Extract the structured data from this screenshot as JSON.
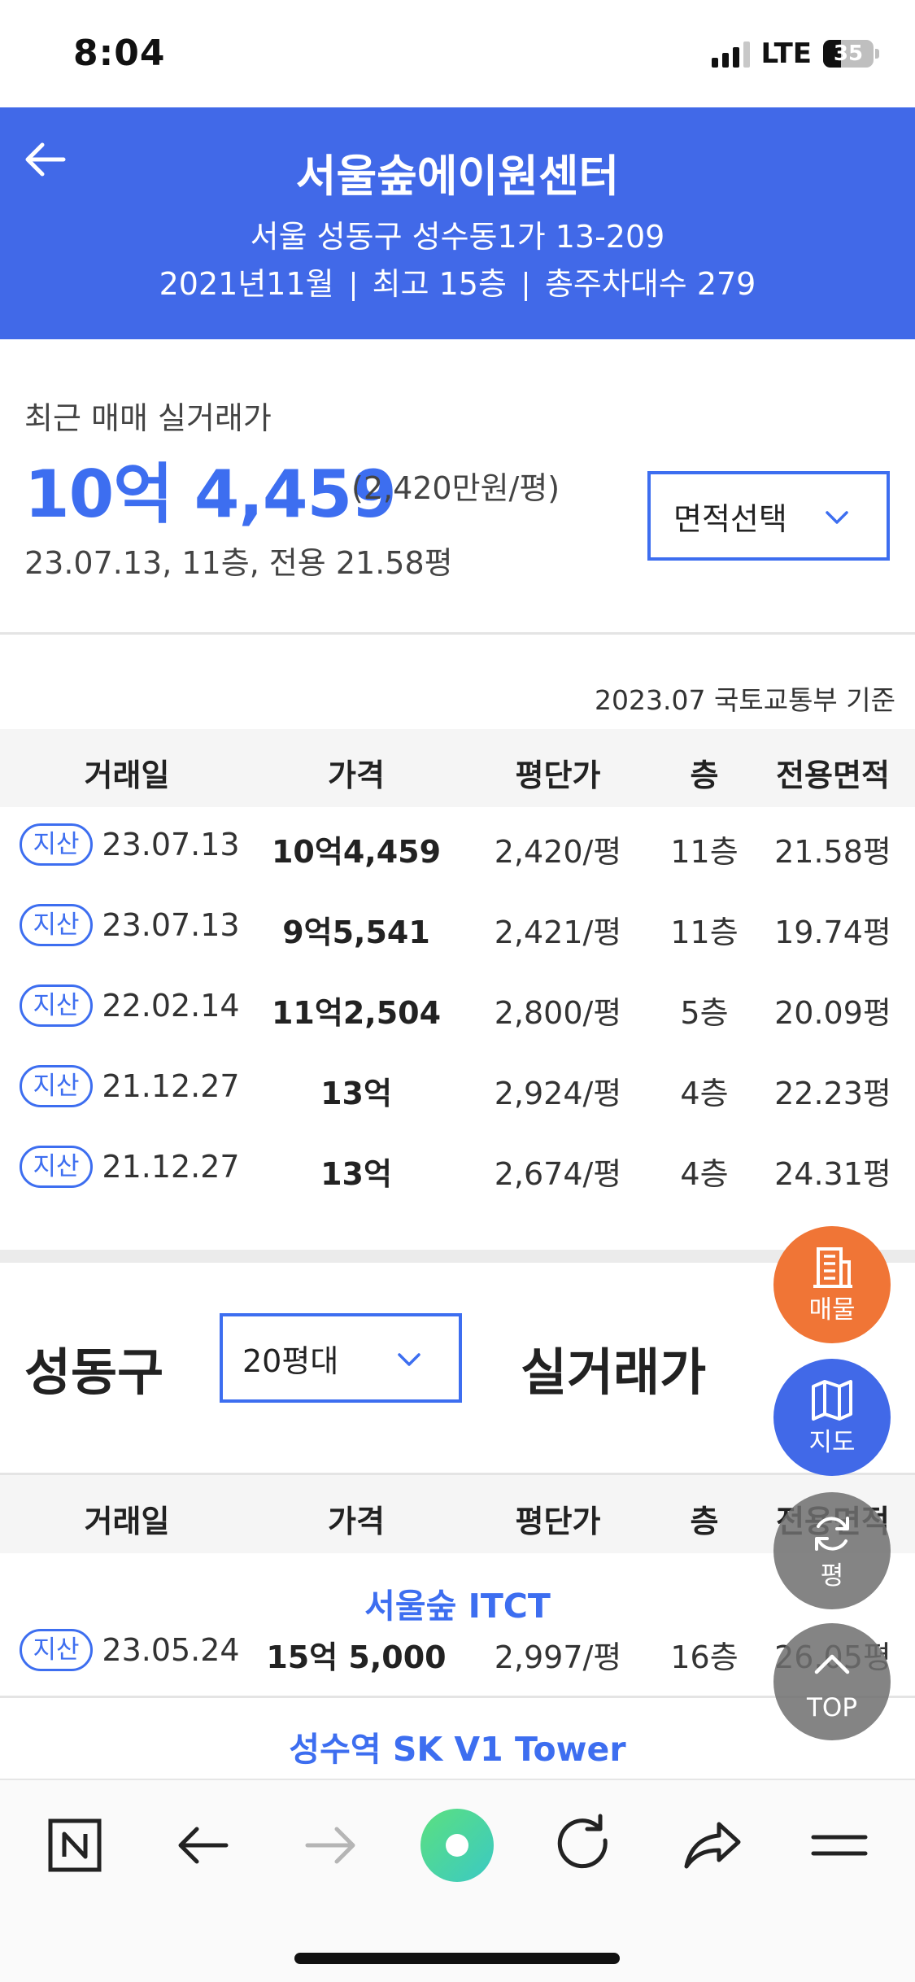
{
  "status_bar": {
    "time": "8:04",
    "network": "LTE",
    "battery": "35",
    "battery_level": 0.35
  },
  "header": {
    "title": "서울숲에이원센터",
    "address": "서울 성동구 성수동1가 13-209",
    "meta": [
      "2021년11월",
      "최고 15층",
      "총주차대수 279"
    ]
  },
  "recent": {
    "label": "최근 매매 실거래가",
    "price": "10억 4,459",
    "unit_price": "(2,420만원/평)",
    "detail": "23.07.13, 11층, 전용 21.58평",
    "area_select": "면적선택"
  },
  "basis": "2023.07 국토교통부 기준",
  "table_headers": [
    "거래일",
    "가격",
    "평단가",
    "층",
    "전용면적"
  ],
  "transactions": [
    {
      "badge": "지산",
      "date": "23.07.13",
      "price": "10억4,459",
      "unit": "2,420/평",
      "floor": "11층",
      "area": "21.58평"
    },
    {
      "badge": "지산",
      "date": "23.07.13",
      "price": "9억5,541",
      "unit": "2,421/평",
      "floor": "11층",
      "area": "19.74평"
    },
    {
      "badge": "지산",
      "date": "22.02.14",
      "price": "11억2,504",
      "unit": "2,800/평",
      "floor": "5층",
      "area": "20.09평"
    },
    {
      "badge": "지산",
      "date": "21.12.27",
      "price": "13억",
      "unit": "2,924/평",
      "floor": "4층",
      "area": "22.23평"
    },
    {
      "badge": "지산",
      "date": "21.12.27",
      "price": "13억",
      "unit": "2,674/평",
      "floor": "4층",
      "area": "24.31평"
    }
  ],
  "region": {
    "name": "성동구",
    "range": "20평대",
    "suffix": "실거래가"
  },
  "region_transactions": [
    {
      "complex": "서울숲 ITCT",
      "badge": "지산",
      "date": "23.05.24",
      "price": "15억 5,000",
      "unit": "2,997/평",
      "floor": "16층",
      "area": "26.05평"
    }
  ],
  "next_complex": "성수역 SK V1 Tower",
  "fabs": {
    "listing": "매물",
    "map": "지도",
    "unit": "평",
    "top": "TOP"
  },
  "colors": {
    "primary": "#4169e8",
    "accent_blue": "#3d6ef0",
    "orange": "#f07536"
  },
  "icons": [
    "back-arrow-icon",
    "chevron-down-icon",
    "building-icon",
    "map-icon",
    "refresh-icon",
    "chevron-up-icon",
    "naver-n-icon",
    "forward-arrow-icon",
    "share-icon",
    "menu-icon"
  ]
}
